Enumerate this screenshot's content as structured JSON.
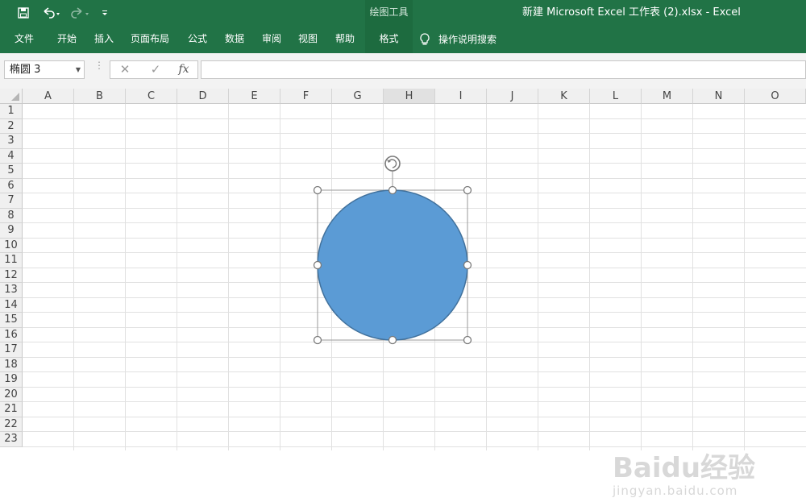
{
  "window": {
    "title": "新建 Microsoft Excel 工作表 (2).xlsx  -  Excel",
    "context_group": "绘图工具"
  },
  "quick_access": {
    "icons": [
      "save-icon",
      "undo-icon",
      "redo-icon",
      "customize-icon"
    ]
  },
  "ribbon": {
    "tabs": [
      {
        "label": "文件"
      },
      {
        "label": "开始"
      },
      {
        "label": "插入"
      },
      {
        "label": "页面布局"
      },
      {
        "label": "公式"
      },
      {
        "label": "数据"
      },
      {
        "label": "审阅"
      },
      {
        "label": "视图"
      },
      {
        "label": "帮助"
      },
      {
        "label": "格式",
        "active": true
      }
    ],
    "tell_me": "操作说明搜索"
  },
  "formula_bar": {
    "name_box": "椭圆 3",
    "fx_label": "fx",
    "formula": ""
  },
  "sheet": {
    "columns": [
      "A",
      "B",
      "C",
      "D",
      "E",
      "F",
      "G",
      "H",
      "I",
      "J",
      "K",
      "L",
      "M",
      "N",
      "O"
    ],
    "rows": [
      "1",
      "2",
      "3",
      "4",
      "5",
      "6",
      "7",
      "8",
      "9",
      "10",
      "11",
      "12",
      "13",
      "14",
      "15",
      "16",
      "17",
      "18",
      "19",
      "20",
      "21",
      "22",
      "23"
    ]
  },
  "shape": {
    "type": "ellipse",
    "fill": "#5b9bd5",
    "stroke": "#41719c",
    "selected": true
  },
  "colors": {
    "ribbon": "#217346",
    "active_tab": "#1d6b3f"
  },
  "watermark": {
    "line1": "Baidu经验",
    "line2": "jingyan.baidu.com"
  }
}
